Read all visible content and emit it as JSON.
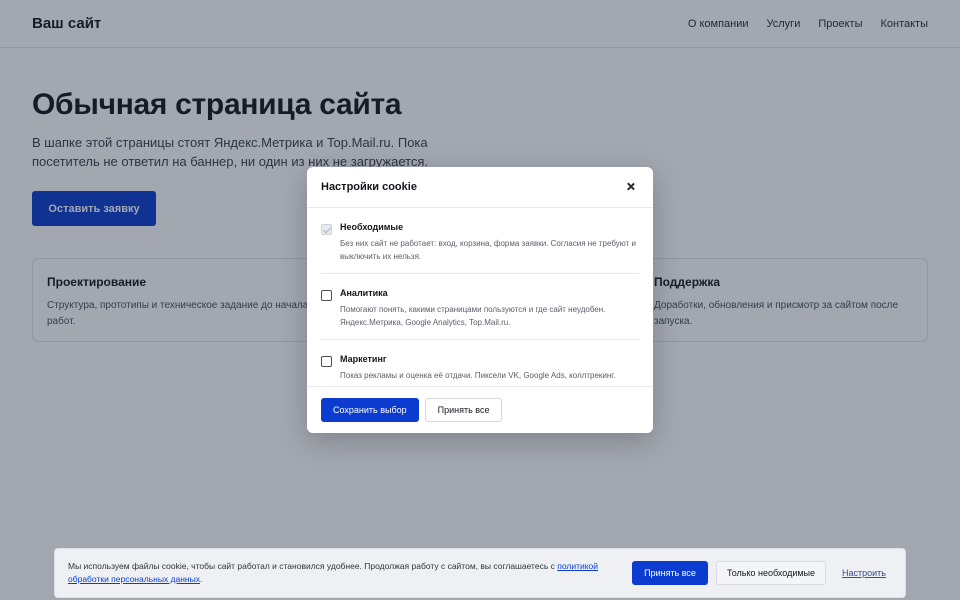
{
  "header": {
    "logo": "Ваш сайт",
    "nav": [
      "О компании",
      "Услуги",
      "Проекты",
      "Контакты"
    ]
  },
  "hero": {
    "title": "Обычная страница сайта",
    "text": "В шапке этой страницы стоят Яндекс.Метрика и Top.Mail.ru. Пока посетитель не ответил на баннер, ни один из них не загружается.",
    "cta": "Оставить заявку"
  },
  "cards": [
    {
      "title": "Проектирование",
      "text": "Структура, прототипы и техническое задание до начала работ."
    },
    {
      "title": "Поддержка",
      "text": "Доработки, обновления и присмотр за сайтом после запуска."
    }
  ],
  "modal": {
    "title": "Настройки cookie",
    "options": [
      {
        "title": "Необходимые",
        "desc": "Без них сайт не работает: вход, корзина, форма заявки. Согласия не требуют и выключить их нельзя.",
        "checked": true,
        "disabled": true
      },
      {
        "title": "Аналитика",
        "desc": "Помогают понять, какими страницами пользуются и где сайт неудобен. Яндекс.Метрика, Google Analytics, Top.Mail.ru.",
        "checked": false,
        "disabled": false
      },
      {
        "title": "Маркетинг",
        "desc": "Показ рекламы и оценка её отдачи. Пиксели VK, Google Ads, коллтрекинг.",
        "checked": false,
        "disabled": false
      }
    ],
    "save_label": "Сохранить выбор",
    "accept_all_label": "Принять все"
  },
  "banner": {
    "text": "Мы используем файлы cookie, чтобы сайт работал и становился удобнее. Продолжая работу с сайтом, вы соглашаетесь с ",
    "link": "политикой обработки персональных данных",
    "text_end": ".",
    "accept_all": "Принять все",
    "only_necessary": "Только необходимые",
    "settings": "Настроить"
  },
  "colors": {
    "accent": "#0b3ccf",
    "overlay": "#1a223a"
  }
}
